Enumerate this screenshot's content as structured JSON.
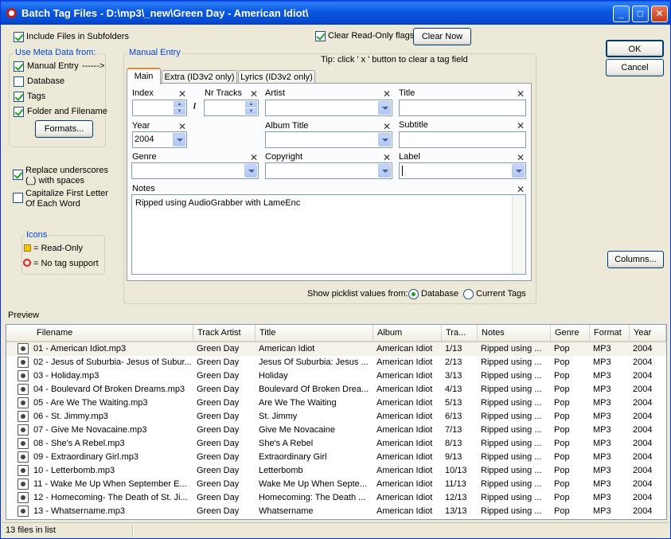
{
  "window": {
    "title": "Batch Tag Files - D:\\mp3\\_new\\Green Day - American Idiot\\"
  },
  "options": {
    "include_subfolders": "Include Files in Subfolders",
    "clear_readonly": "Clear Read-Only flags",
    "clear_now": "Clear Now",
    "ok": "OK",
    "cancel": "Cancel",
    "columns": "Columns..."
  },
  "meta": {
    "group_title": "Use Meta Data from:",
    "manual_entry": "Manual Entry",
    "manual_arrow": "------>",
    "database": "Database",
    "tags": "Tags",
    "folder_filename": "Folder and Filename",
    "formats": "Formats..."
  },
  "replace_underscores": "Replace underscores (_) with spaces",
  "capitalize": "Capitalize First Letter Of Each Word",
  "icons": {
    "title": "Icons",
    "readonly": "= Read-Only",
    "notag": "= No tag support"
  },
  "manual": {
    "group_title": "Manual Entry",
    "tip": "Tip: click ' x ' button to clear a tag field",
    "tabs": [
      "Main",
      "Extra (ID3v2 only)",
      "Lyrics (ID3v2 only)"
    ],
    "index_label": "Index",
    "nrtracks_label": "Nr Tracks",
    "slash": "/",
    "artist_label": "Artist",
    "title_label": "Title",
    "year_label": "Year",
    "year_value": "2004",
    "album_label": "Album Title",
    "subtitle_label": "Subtitle",
    "genre_label": "Genre",
    "copyright_label": "Copyright",
    "label_label": "Label",
    "notes_label": "Notes",
    "notes_value": "Ripped using AudioGrabber with LameEnc",
    "picklist_label": "Show picklist values from:",
    "picklist_options": [
      "Database",
      "Current Tags"
    ],
    "clear_x": "X"
  },
  "preview_label": "Preview",
  "columns": [
    "Filename",
    "Track Artist",
    "Title",
    "Album",
    "Tra...",
    "Notes",
    "Genre",
    "Format",
    "Year"
  ],
  "rows": [
    [
      "01 - American Idiot.mp3",
      "Green Day",
      "American Idiot",
      "American Idiot",
      "1/13",
      "Ripped using ...",
      "Pop",
      "MP3",
      "2004"
    ],
    [
      "02 - Jesus of Suburbia- Jesus of Subur...",
      "Green Day",
      "Jesus Of Suburbia: Jesus ...",
      "American Idiot",
      "2/13",
      "Ripped using ...",
      "Pop",
      "MP3",
      "2004"
    ],
    [
      "03 - Holiday.mp3",
      "Green Day",
      "Holiday",
      "American Idiot",
      "3/13",
      "Ripped using ...",
      "Pop",
      "MP3",
      "2004"
    ],
    [
      "04 - Boulevard Of Broken Dreams.mp3",
      "Green Day",
      "Boulevard Of Broken Drea...",
      "American Idiot",
      "4/13",
      "Ripped using ...",
      "Pop",
      "MP3",
      "2004"
    ],
    [
      "05 - Are We The Waiting.mp3",
      "Green Day",
      "Are We The Waiting",
      "American Idiot",
      "5/13",
      "Ripped using ...",
      "Pop",
      "MP3",
      "2004"
    ],
    [
      "06 - St. Jimmy.mp3",
      "Green Day",
      "St. Jimmy",
      "American Idiot",
      "6/13",
      "Ripped using ...",
      "Pop",
      "MP3",
      "2004"
    ],
    [
      "07 - Give Me Novacaine.mp3",
      "Green Day",
      "Give Me Novacaine",
      "American Idiot",
      "7/13",
      "Ripped using ...",
      "Pop",
      "MP3",
      "2004"
    ],
    [
      "08 - She's A Rebel.mp3",
      "Green Day",
      "She's A Rebel",
      "American Idiot",
      "8/13",
      "Ripped using ...",
      "Pop",
      "MP3",
      "2004"
    ],
    [
      "09 - Extraordinary Girl.mp3",
      "Green Day",
      "Extraordinary Girl",
      "American Idiot",
      "9/13",
      "Ripped using ...",
      "Pop",
      "MP3",
      "2004"
    ],
    [
      "10 - Letterbomb.mp3",
      "Green Day",
      "Letterbomb",
      "American Idiot",
      "10/13",
      "Ripped using ...",
      "Pop",
      "MP3",
      "2004"
    ],
    [
      "11 - Wake Me Up When September E...",
      "Green Day",
      "Wake Me Up When Septe...",
      "American Idiot",
      "11/13",
      "Ripped using ...",
      "Pop",
      "MP3",
      "2004"
    ],
    [
      "12 - Homecoming- The Death of St. Ji...",
      "Green Day",
      "Homecoming: The Death ...",
      "American Idiot",
      "12/13",
      "Ripped using ...",
      "Pop",
      "MP3",
      "2004"
    ],
    [
      "13 - Whatsername.mp3",
      "Green Day",
      "Whatsername",
      "American Idiot",
      "13/13",
      "Ripped using ...",
      "Pop",
      "MP3",
      "2004"
    ]
  ],
  "status": "13 files in list"
}
